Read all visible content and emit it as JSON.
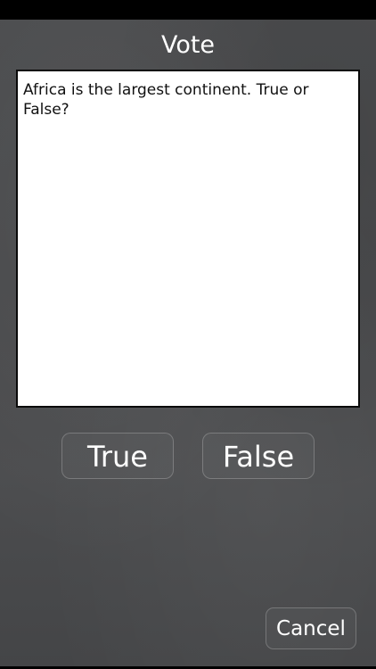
{
  "title": "Vote",
  "question": {
    "text": "Africa is the largest continent. True or False?"
  },
  "answers": {
    "true_label": "True",
    "false_label": "False"
  },
  "cancel_label": "Cancel",
  "colors": {
    "background": "#4a4b4d",
    "text": "#ffffff",
    "question_bg": "#ffffff",
    "question_border": "#0a0a0a",
    "question_text": "#111111"
  }
}
